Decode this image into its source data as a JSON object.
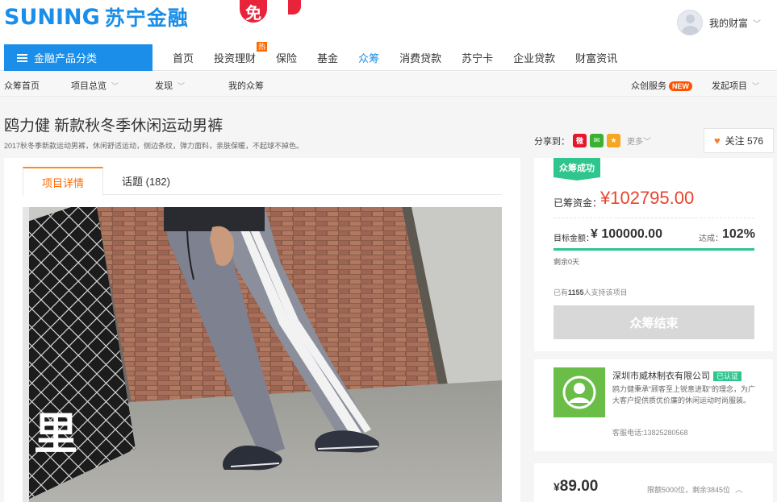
{
  "header": {
    "logo_en": "SUNING",
    "logo_cn": "苏宁金融",
    "promo_badge": "免",
    "user_label": "我的财富",
    "user_caret": "﹀"
  },
  "mainnav": {
    "category_label": "金融产品分类",
    "links": [
      {
        "label": "首页"
      },
      {
        "label": "投资理财",
        "tag": "热"
      },
      {
        "label": "保险"
      },
      {
        "label": "基金"
      },
      {
        "label": "众筹",
        "active": true
      },
      {
        "label": "消费贷款"
      },
      {
        "label": "苏宁卡"
      },
      {
        "label": "企业贷款"
      },
      {
        "label": "财富资讯"
      }
    ]
  },
  "subnav": {
    "home": "众筹首页",
    "overview": "项目总览",
    "discover": "发现",
    "mine": "我的众筹",
    "services": "众创服务",
    "services_tag": "NEW",
    "launch": "发起项目"
  },
  "project": {
    "title": "鸥力健 新款秋冬季休闲运动男裤",
    "subtitle": "2017秋冬季新款运动男裤，休闲舒适运动，侧边条纹，弹力面料，亲肤保暖，不起球不掉色。",
    "share_label": "分享到：",
    "share_more": "更多﹀",
    "follow_label": "关注",
    "follow_count": "576"
  },
  "tabs": [
    {
      "label": "项目详情",
      "active": true
    },
    {
      "label": "话题 (182)"
    }
  ],
  "funding": {
    "status_tag": "众筹成功",
    "raised_label": "已筹资金：",
    "raised_value": "¥102795.00",
    "target_label": "目标金额：",
    "target_value": "¥ 100000.00",
    "reach_label": "达成：",
    "reach_value": "102%",
    "progress": 1.0,
    "days_left": "剩余0天",
    "supporters_prefix": "已有",
    "supporters_count": "1155",
    "supporters_suffix": "人支持该项目",
    "end_button": "众筹结束"
  },
  "company": {
    "name": "深圳市威林制衣有限公司",
    "verified": "已认证",
    "description": "鸥力健秉承“顾客至上锐意进取”的理念，为广大客户提供质优价廉的休闲运动时尚服装。",
    "phone": "客服电话:13825280568"
  },
  "reward": {
    "currency": "¥",
    "price": "89.00",
    "quota": "限额5000位，剩余3845位"
  },
  "colors": {
    "brand_blue": "#1a8ee8",
    "accent_orange": "#ff6a00",
    "price_red": "#e8452c",
    "success_green": "#2fc58e"
  }
}
